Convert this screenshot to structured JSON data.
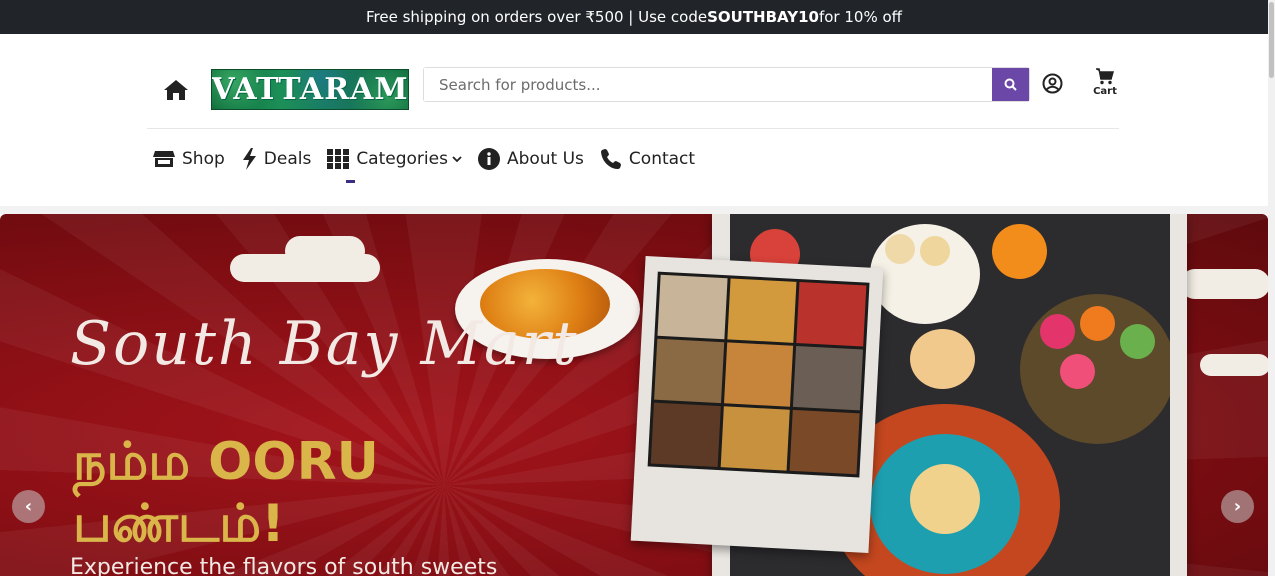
{
  "announcement": {
    "prefix": "Free shipping on orders over ₹500 | Use code ",
    "code": "SOUTHBAY10",
    "suffix": " for 10% off"
  },
  "header": {
    "logo_text": "VATTARAM",
    "search_placeholder": "Search for products...",
    "cart_label": "Cart"
  },
  "nav": {
    "items": [
      {
        "label": "Shop",
        "icon": "store-icon"
      },
      {
        "label": "Deals",
        "icon": "bolt-icon"
      },
      {
        "label": "Categories",
        "icon": "grid-icon"
      },
      {
        "label": "About Us",
        "icon": "info-icon"
      },
      {
        "label": "Contact",
        "icon": "phone-icon"
      }
    ]
  },
  "hero": {
    "script_title": "South Bay Mart",
    "tamil_line1": "நம்ம OORU",
    "tamil_line2": "பண்டம்!",
    "tagline": "Experience the flavors of south sweets",
    "prev_label": "‹",
    "next_label": "›"
  },
  "colors": {
    "topbar_bg": "#212529",
    "accent": "#6b47a8",
    "hero_red": "#8b1014",
    "hero_gold": "#d9b54a"
  }
}
